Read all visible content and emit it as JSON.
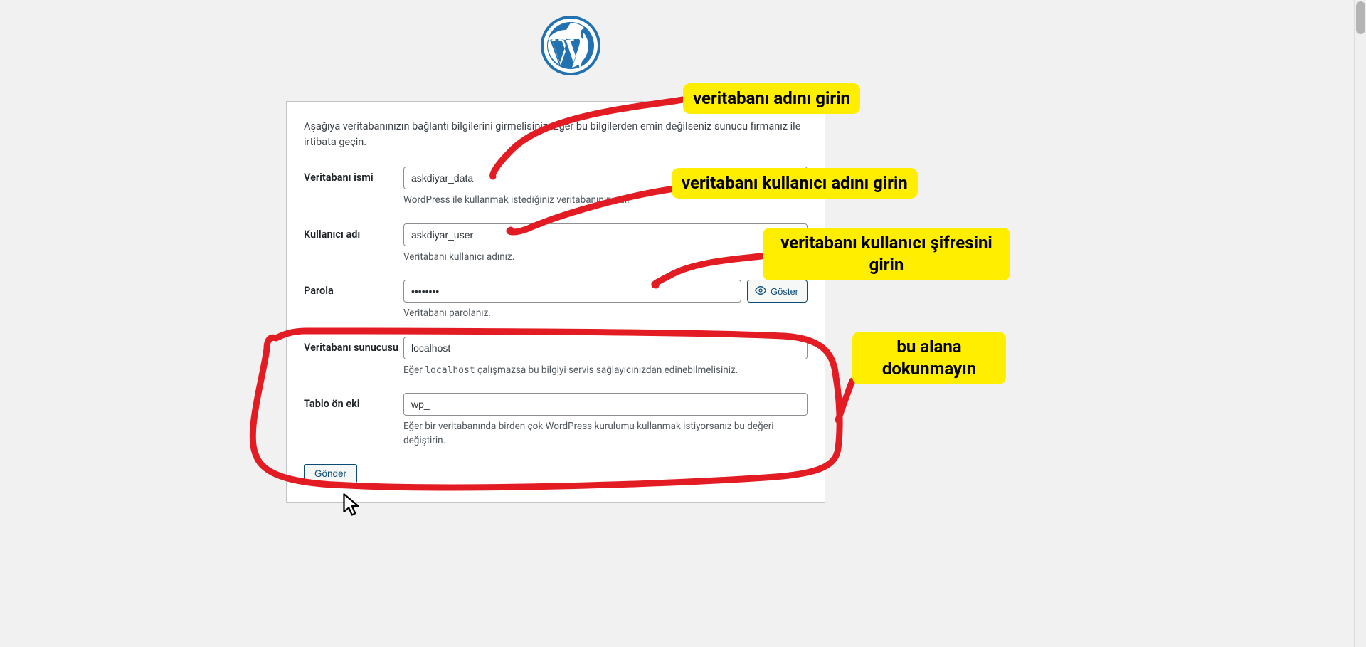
{
  "intro_text": "Aşağıya veritabanınızın bağlantı bilgilerini girmelisiniz. Eğer bu bilgilerden emin değilseniz sunucu firmanız ile irtibata geçin.",
  "fields": {
    "dbname": {
      "label": "Veritabanı ismi",
      "value": "askdiyar_data",
      "desc": "WordPress ile kullanmak istediğiniz veritabanının adı."
    },
    "uname": {
      "label": "Kullanıcı adı",
      "value": "askdiyar_user",
      "desc": "Veritabanı kullanıcı adınız."
    },
    "pwd": {
      "label": "Parola",
      "value": "••••••••",
      "desc": "Veritabanı parolanız.",
      "show_btn": "Göster"
    },
    "dbhost": {
      "label": "Veritabanı sunucusu",
      "value": "localhost",
      "desc_pre": "Eğer ",
      "desc_code": "localhost",
      "desc_post": " çalışmazsa bu bilgiyi servis sağlayıcınızdan edinebilmelisiniz."
    },
    "prefix": {
      "label": "Tablo ön eki",
      "value": "wp_",
      "desc": "Eğer bir veritabanında birden çok WordPress kurulumu kullanmak istiyorsanız bu değeri değiştirin."
    }
  },
  "submit_label": "Gönder",
  "annotations": {
    "a1": "veritabanı adını girin",
    "a2": "veritabanı kullanıcı adını girin",
    "a3": "veritabanı kullanıcı şifresini girin",
    "a4": "bu alana dokunmayın"
  }
}
